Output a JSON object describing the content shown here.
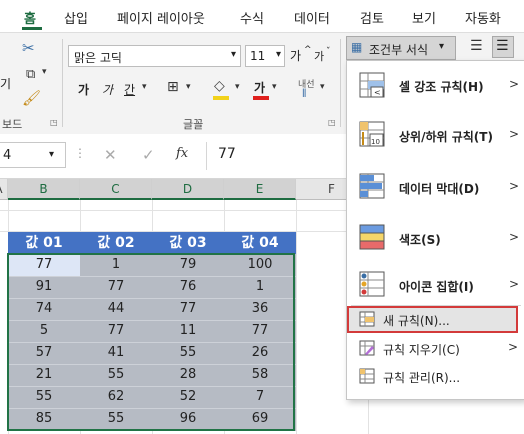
{
  "tabs": [
    {
      "label": "홈"
    },
    {
      "label": "삽입"
    },
    {
      "label": "페이지 레이아웃"
    },
    {
      "label": "수식"
    },
    {
      "label": "데이터"
    },
    {
      "label": "검토"
    },
    {
      "label": "보기"
    },
    {
      "label": "자동화"
    }
  ],
  "ribbon": {
    "clipboard_partial_label": "기",
    "clipboard_group_label": "보드",
    "font_name": "맑은 고딕",
    "font_size": "11",
    "font_group_label": "글꼴",
    "phonetic_label": "내선",
    "conditional_format_label": "조건부 서식",
    "grow_font": "가",
    "shrink_font": "가",
    "bold": "가",
    "italic": "가",
    "underline": "간",
    "font_color_glyph": "가"
  },
  "formula_bar": {
    "name_box": "4",
    "fx": "fx",
    "value": "77"
  },
  "columns": [
    "A",
    "B",
    "C",
    "D",
    "E",
    "F"
  ],
  "table": {
    "headers": [
      "값 01",
      "값 02",
      "값 03",
      "값 04"
    ],
    "rows": [
      [
        "77",
        "1",
        "79",
        "100"
      ],
      [
        "91",
        "77",
        "76",
        "1"
      ],
      [
        "74",
        "44",
        "77",
        "36"
      ],
      [
        "5",
        "77",
        "11",
        "77"
      ],
      [
        "57",
        "41",
        "55",
        "26"
      ],
      [
        "21",
        "55",
        "28",
        "58"
      ],
      [
        "55",
        "62",
        "52",
        "7"
      ],
      [
        "85",
        "55",
        "96",
        "69"
      ]
    ]
  },
  "menu": {
    "items": [
      {
        "label": "셀 강조 규칙(H)",
        "icon": "highlight-cells-rules-icon"
      },
      {
        "label": "상위/하위 규칙(T)",
        "icon": "top-bottom-rules-icon"
      },
      {
        "label": "데이터 막대(D)",
        "icon": "data-bars-icon"
      },
      {
        "label": "색조(S)",
        "icon": "color-scales-icon"
      },
      {
        "label": "아이콘 집합(I)",
        "icon": "icon-sets-icon"
      }
    ],
    "new_rule": "새 규칙(N)...",
    "clear_rules": "규칙 지우기(C)",
    "manage_rules": "규칙 관리(R)..."
  },
  "colors": {
    "accent": "#1e6c41",
    "table_header": "#4472c4",
    "selection": "#b6bbc4",
    "highlight_border": "#d33a3a"
  }
}
